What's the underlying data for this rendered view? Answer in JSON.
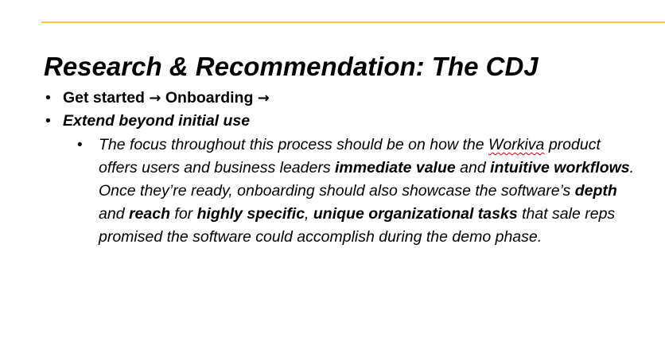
{
  "slide": {
    "title": "Research & Recommendation: The CDJ",
    "accent_rule_color": "#f6c343",
    "bullets": [
      {
        "marker": "•",
        "part1": "Get started ",
        "arrow1": "→",
        "part2": " Onboarding ",
        "arrow2": "→"
      },
      {
        "marker": "•",
        "text": "Extend beyond initial use"
      }
    ],
    "sub_bullet": {
      "marker": "•",
      "segments": [
        "The focus throughout this process should be on how the ",
        "Workiva",
        " product offers users and business leaders ",
        "immediate value",
        " and ",
        "intuitive workflows",
        ". Once they’re ready, onboarding should also showcase the software’s ",
        "depth",
        " and ",
        "reach",
        " for ",
        "highly specific",
        ", ",
        "unique organizational tasks",
        " that sale reps promised the software could accomplish during the demo phase."
      ]
    }
  }
}
